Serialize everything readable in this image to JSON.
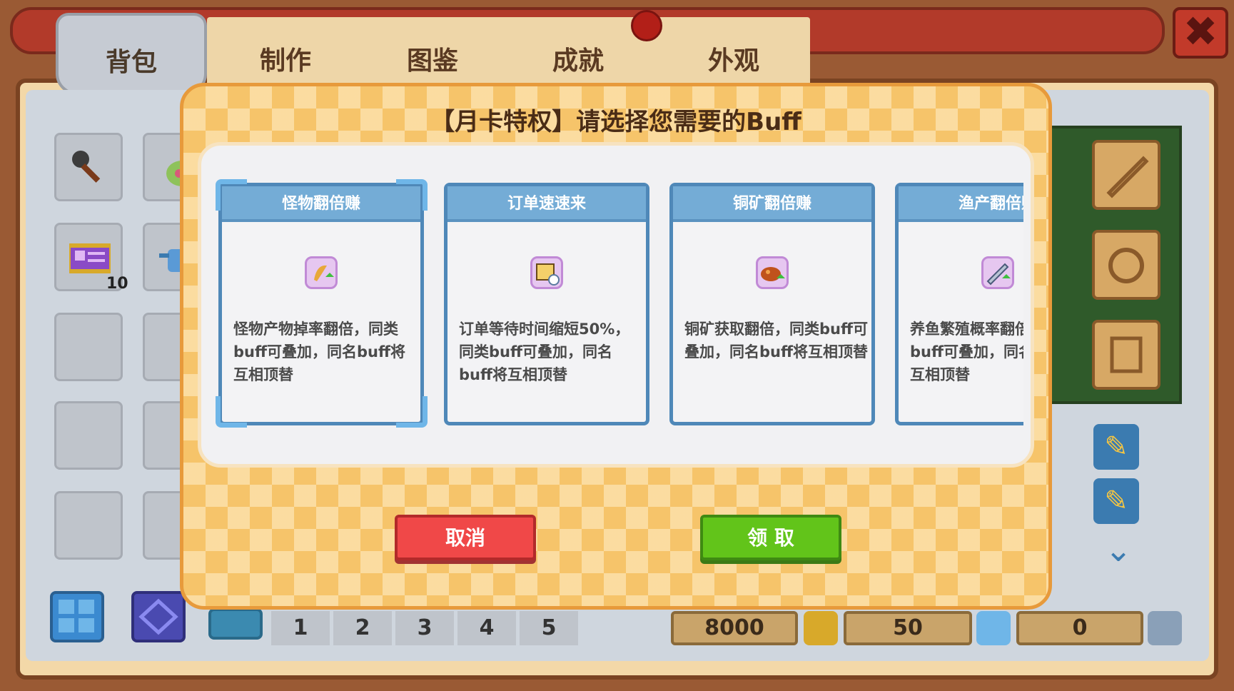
{
  "tabs": [
    "背包",
    "制作",
    "图鉴",
    "成就",
    "外观"
  ],
  "close_label": "✖",
  "inventory": {
    "id_card_qty": "10"
  },
  "pages": [
    "1",
    "2",
    "3",
    "4",
    "5"
  ],
  "currencies": {
    "gold": "8000",
    "gems": "50",
    "third": "0"
  },
  "modal": {
    "title": "【月卡特权】请选择您需要的Buff",
    "cards": [
      {
        "title": "怪物翻倍赚",
        "desc": "怪物产物掉率翻倍，同类buff可叠加，同名buff将互相顶替",
        "icon": "monster-drop-icon",
        "selected": true
      },
      {
        "title": "订单速速来",
        "desc": "订单等待时间缩短50%，同类buff可叠加，同名buff将互相顶替",
        "icon": "order-clock-icon",
        "selected": false
      },
      {
        "title": "铜矿翻倍赚",
        "desc": "铜矿获取翻倍，同类buff可叠加，同名buff将互相顶替",
        "icon": "copper-ore-icon",
        "selected": false
      },
      {
        "title": "渔产翻倍赚",
        "desc": "养鱼繁殖概率翻倍，同类buff可叠加，同名buff将互相顶替",
        "icon": "fish-icon",
        "selected": false
      }
    ],
    "cancel_label": "取消",
    "claim_label": "领  取"
  },
  "colors": {
    "card_border": "#4f88b8",
    "card_header": "#74acd6",
    "cancel": "#f04848",
    "claim": "#62c41a",
    "modal_bg": "#f6c46a"
  }
}
